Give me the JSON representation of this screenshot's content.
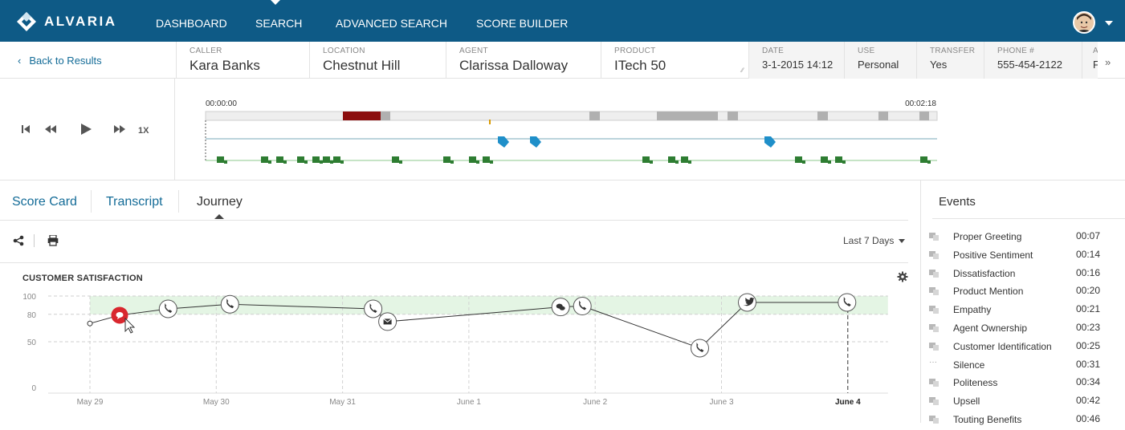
{
  "brand": {
    "name": "ALVARIA"
  },
  "nav": {
    "items": [
      {
        "label": "DASHBOARD"
      },
      {
        "label": "SEARCH"
      },
      {
        "label": "ADVANCED SEARCH"
      },
      {
        "label": "SCORE BUILDER"
      }
    ]
  },
  "infobar": {
    "back_label": "Back to Results",
    "caller": {
      "label": "CALLER",
      "value": "Kara Banks"
    },
    "location": {
      "label": "LOCATION",
      "value": "Chestnut Hill"
    },
    "agent": {
      "label": "AGENT",
      "value": "Clarissa Dalloway"
    },
    "product": {
      "label": "PRODUCT",
      "value": "ITech 50"
    },
    "date": {
      "label": "DATE",
      "value": "3-1-2015 14:12"
    },
    "use": {
      "label": "USE",
      "value": "Personal"
    },
    "transfer": {
      "label": "TRANSFER",
      "value": "Yes"
    },
    "phone": {
      "label": "PHONE #",
      "value": "555-454-2122"
    },
    "extra": {
      "label": "A",
      "value": "F"
    }
  },
  "player": {
    "speed": "1X",
    "start_time": "00:00:00",
    "end_time": "00:02:18"
  },
  "tabs": [
    {
      "label": "Score Card"
    },
    {
      "label": "Transcript"
    },
    {
      "label": "Journey"
    }
  ],
  "toolbar": {
    "range_label": "Last 7 Days"
  },
  "chart": {
    "title": "CUSTOMER SATISFACTION",
    "colors": {
      "band": "#e4f5e4",
      "line": "#333333",
      "highlight": "#d9272e"
    }
  },
  "chart_data": {
    "type": "line",
    "x_labels": [
      "May 29",
      "May 30",
      "May 31",
      "June 1",
      "June 2",
      "June 3",
      "June 4"
    ],
    "y_ticks": [
      0,
      50,
      80,
      100
    ],
    "ylim": [
      0,
      100
    ],
    "target_band": [
      80,
      100
    ],
    "series": [
      {
        "values": [
          {
            "x": "May 29",
            "y": 70,
            "icon": "dot"
          },
          {
            "x": "May 29",
            "y": 79,
            "icon": "chat-bubble"
          },
          {
            "x": "May 30",
            "y": 86,
            "icon": "phone"
          },
          {
            "x": "May 30",
            "y": 91,
            "icon": "phone"
          },
          {
            "x": "May 31",
            "y": 86,
            "icon": "phone"
          },
          {
            "x": "May 31",
            "y": 72,
            "icon": "email"
          },
          {
            "x": "June 2",
            "y": 88,
            "icon": "chat"
          },
          {
            "x": "June 2",
            "y": 89,
            "icon": "phone"
          },
          {
            "x": "June 3",
            "y": 43,
            "icon": "phone"
          },
          {
            "x": "June 3",
            "y": 93,
            "icon": "twitter"
          },
          {
            "x": "June 4",
            "y": 93,
            "icon": "phone"
          }
        ]
      }
    ]
  },
  "events": {
    "title": "Events",
    "items": [
      {
        "name": "Proper Greeting",
        "time": "00:07",
        "icon": "chat-icon"
      },
      {
        "name": "Positive Sentiment",
        "time": "00:14",
        "icon": "chat-icon"
      },
      {
        "name": "Dissatisfaction",
        "time": "00:16",
        "icon": "chat-icon"
      },
      {
        "name": "Product Mention",
        "time": "00:20",
        "icon": "chat-icon"
      },
      {
        "name": "Empathy",
        "time": "00:21",
        "icon": "chat-icon"
      },
      {
        "name": "Agent Ownership",
        "time": "00:23",
        "icon": "chat-icon"
      },
      {
        "name": "Customer Identification",
        "time": "00:25",
        "icon": "chat-icon"
      },
      {
        "name": "Silence",
        "time": "00:31",
        "icon": "silence-icon"
      },
      {
        "name": "Politeness",
        "time": "00:34",
        "icon": "chat-icon"
      },
      {
        "name": "Upsell",
        "time": "00:42",
        "icon": "chat-icon"
      },
      {
        "name": "Touting Benefits",
        "time": "00:46",
        "icon": "chat-icon"
      }
    ]
  }
}
